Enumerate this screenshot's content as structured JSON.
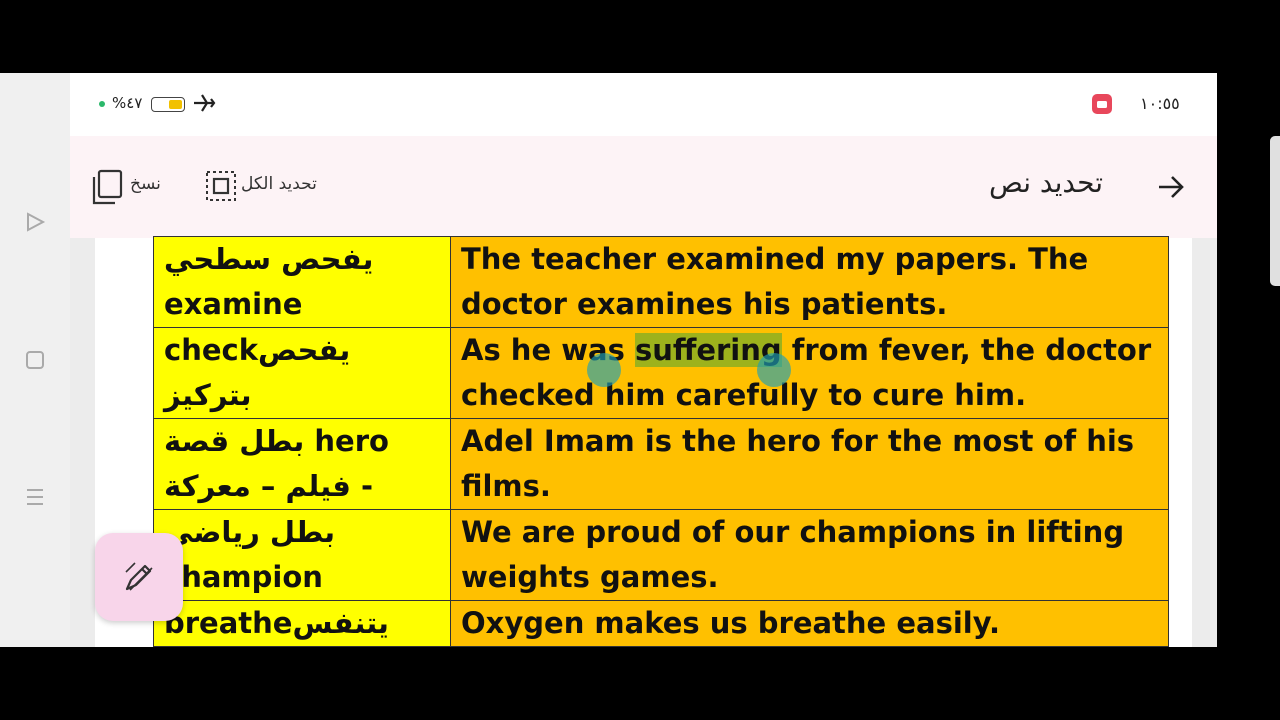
{
  "status": {
    "time": "١٠:٥٥",
    "battery_pct": "%٤٧",
    "battery_level": 0.47
  },
  "toolbar": {
    "title": "تحديد نص",
    "select_all": "تحديد الكل",
    "copy": "نسخ"
  },
  "rows": [
    {
      "word": "يفحص سطحي examine",
      "examples": "The teacher examined my papers. The doctor examines his patients."
    },
    {
      "word": "checkيفحص بتركيز",
      "examples": "As he was suffering from fever, the doctor checked him carefully to cure him."
    },
    {
      "word": "بطل قصة hero فيلم – معركة -",
      "examples": "Adel Imam is the hero for the most of his films."
    },
    {
      "word": "بطل رياضي champion",
      "examples": "We are proud of our champions in lifting weights games."
    },
    {
      "word": "breatheيتنفس",
      "examples": "Oxygen makes us breathe easily."
    }
  ],
  "highlight": {
    "row": 1,
    "before": "As he was ",
    "word": "suffering",
    "after": " from fever, the doctor checked him carefully to cure him."
  },
  "colors": {
    "word_cell": "#ffff00",
    "example_cell": "#ffc000",
    "highlight": "#9db21c",
    "handles": "#1fa0b5",
    "recording": "#e8475b"
  }
}
